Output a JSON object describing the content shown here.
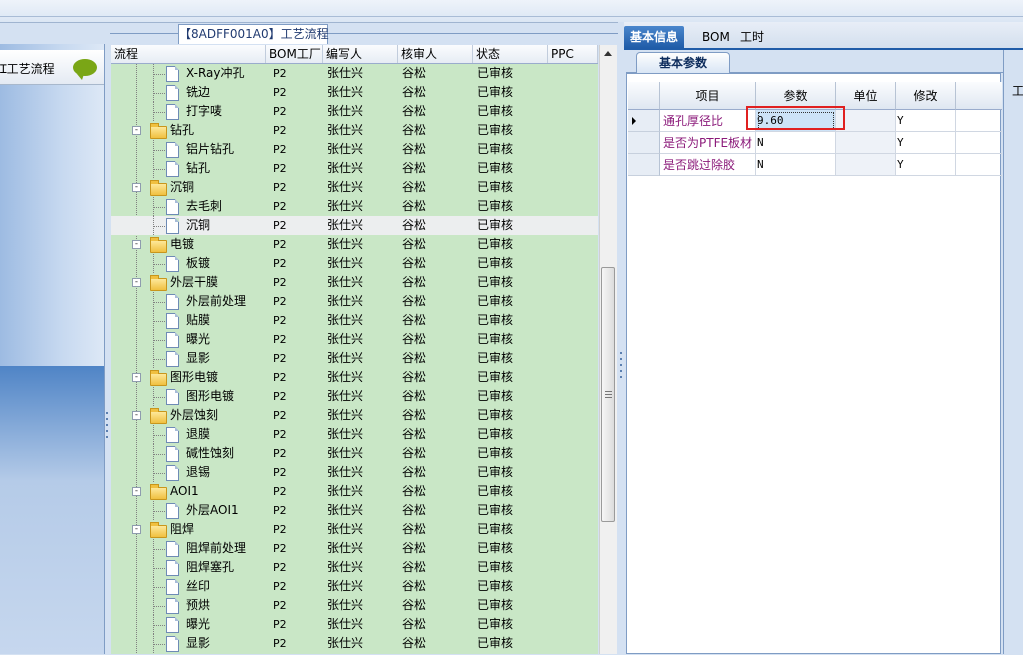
{
  "left_panel": {
    "item_label": "Ɪ工艺流程",
    "bubble_icon": "speech-bubble-icon"
  },
  "middle": {
    "caption": "【8ADFF001A0】工艺流程",
    "columns": [
      "流程",
      "BOM工厂",
      "编写人",
      "核审人",
      "状态",
      "PPC"
    ],
    "rows": [
      {
        "name": "X-Ray冲孔",
        "level": 2,
        "type": "file",
        "bom": "P2",
        "writer": "张仕兴",
        "reviewer": "谷松",
        "status": "已审核"
      },
      {
        "name": "铣边",
        "level": 2,
        "type": "file",
        "bom": "P2",
        "writer": "张仕兴",
        "reviewer": "谷松",
        "status": "已审核"
      },
      {
        "name": "打字唛",
        "level": 2,
        "type": "file",
        "bom": "P2",
        "writer": "张仕兴",
        "reviewer": "谷松",
        "status": "已审核"
      },
      {
        "name": "钻孔",
        "level": 1,
        "type": "folder",
        "bom": "P2",
        "writer": "张仕兴",
        "reviewer": "谷松",
        "status": "已审核"
      },
      {
        "name": "铝片钻孔",
        "level": 2,
        "type": "file",
        "bom": "P2",
        "writer": "张仕兴",
        "reviewer": "谷松",
        "status": "已审核"
      },
      {
        "name": "钻孔",
        "level": 2,
        "type": "file",
        "bom": "P2",
        "writer": "张仕兴",
        "reviewer": "谷松",
        "status": "已审核"
      },
      {
        "name": "沉铜",
        "level": 1,
        "type": "folder",
        "bom": "P2",
        "writer": "张仕兴",
        "reviewer": "谷松",
        "status": "已审核"
      },
      {
        "name": "去毛刺",
        "level": 2,
        "type": "file",
        "bom": "P2",
        "writer": "张仕兴",
        "reviewer": "谷松",
        "status": "已审核"
      },
      {
        "name": "沉铜",
        "level": 2,
        "type": "file",
        "bom": "P2",
        "writer": "张仕兴",
        "reviewer": "谷松",
        "status": "已审核",
        "selected": true
      },
      {
        "name": "电镀",
        "level": 1,
        "type": "folder",
        "bom": "P2",
        "writer": "张仕兴",
        "reviewer": "谷松",
        "status": "已审核"
      },
      {
        "name": "板镀",
        "level": 2,
        "type": "file",
        "bom": "P2",
        "writer": "张仕兴",
        "reviewer": "谷松",
        "status": "已审核"
      },
      {
        "name": "外层干膜",
        "level": 1,
        "type": "folder",
        "bom": "P2",
        "writer": "张仕兴",
        "reviewer": "谷松",
        "status": "已审核"
      },
      {
        "name": "外层前处理",
        "level": 2,
        "type": "file",
        "bom": "P2",
        "writer": "张仕兴",
        "reviewer": "谷松",
        "status": "已审核"
      },
      {
        "name": "贴膜",
        "level": 2,
        "type": "file",
        "bom": "P2",
        "writer": "张仕兴",
        "reviewer": "谷松",
        "status": "已审核"
      },
      {
        "name": "曝光",
        "level": 2,
        "type": "file",
        "bom": "P2",
        "writer": "张仕兴",
        "reviewer": "谷松",
        "status": "已审核"
      },
      {
        "name": "显影",
        "level": 2,
        "type": "file",
        "bom": "P2",
        "writer": "张仕兴",
        "reviewer": "谷松",
        "status": "已审核"
      },
      {
        "name": "图形电镀",
        "level": 1,
        "type": "folder",
        "bom": "P2",
        "writer": "张仕兴",
        "reviewer": "谷松",
        "status": "已审核"
      },
      {
        "name": "图形电镀",
        "level": 2,
        "type": "file",
        "bom": "P2",
        "writer": "张仕兴",
        "reviewer": "谷松",
        "status": "已审核"
      },
      {
        "name": "外层蚀刻",
        "level": 1,
        "type": "folder",
        "bom": "P2",
        "writer": "张仕兴",
        "reviewer": "谷松",
        "status": "已审核"
      },
      {
        "name": "退膜",
        "level": 2,
        "type": "file",
        "bom": "P2",
        "writer": "张仕兴",
        "reviewer": "谷松",
        "status": "已审核"
      },
      {
        "name": "碱性蚀刻",
        "level": 2,
        "type": "file",
        "bom": "P2",
        "writer": "张仕兴",
        "reviewer": "谷松",
        "status": "已审核"
      },
      {
        "name": "退锡",
        "level": 2,
        "type": "file",
        "bom": "P2",
        "writer": "张仕兴",
        "reviewer": "谷松",
        "status": "已审核"
      },
      {
        "name": "AOI1",
        "level": 1,
        "type": "folder",
        "bom": "P2",
        "writer": "张仕兴",
        "reviewer": "谷松",
        "status": "已审核"
      },
      {
        "name": "外层AOI1",
        "level": 2,
        "type": "file",
        "bom": "P2",
        "writer": "张仕兴",
        "reviewer": "谷松",
        "status": "已审核"
      },
      {
        "name": "阻焊",
        "level": 1,
        "type": "folder",
        "bom": "P2",
        "writer": "张仕兴",
        "reviewer": "谷松",
        "status": "已审核"
      },
      {
        "name": "阻焊前处理",
        "level": 2,
        "type": "file",
        "bom": "P2",
        "writer": "张仕兴",
        "reviewer": "谷松",
        "status": "已审核"
      },
      {
        "name": "阻焊塞孔",
        "level": 2,
        "type": "file",
        "bom": "P2",
        "writer": "张仕兴",
        "reviewer": "谷松",
        "status": "已审核"
      },
      {
        "name": "丝印",
        "level": 2,
        "type": "file",
        "bom": "P2",
        "writer": "张仕兴",
        "reviewer": "谷松",
        "status": "已审核"
      },
      {
        "name": "预烘",
        "level": 2,
        "type": "file",
        "bom": "P2",
        "writer": "张仕兴",
        "reviewer": "谷松",
        "status": "已审核"
      },
      {
        "name": "曝光",
        "level": 2,
        "type": "file",
        "bom": "P2",
        "writer": "张仕兴",
        "reviewer": "谷松",
        "status": "已审核"
      },
      {
        "name": "显影",
        "level": 2,
        "type": "file",
        "bom": "P2",
        "writer": "张仕兴",
        "reviewer": "谷松",
        "status": "已审核"
      }
    ]
  },
  "right": {
    "tabs": [
      "基本信息",
      "BOM",
      "工时"
    ],
    "active_tab": "基本信息",
    "sub_tab": "基本参数",
    "param_columns": [
      "项目",
      "参数",
      "单位",
      "修改"
    ],
    "params": [
      {
        "item": "通孔厚径比",
        "value": "9.60",
        "unit": "",
        "modify": "Y",
        "highlight": true,
        "current": true
      },
      {
        "item": "是否为PTFE板材",
        "value": "N",
        "unit": "",
        "modify": "Y"
      },
      {
        "item": "是否跳过除胶",
        "value": "N",
        "unit": "",
        "modify": "Y"
      }
    ],
    "edge_label": "工"
  },
  "colors": {
    "grid_bg": "#c9e7c6",
    "accent": "#1f5ca8",
    "param_item_text": "#8b1a7a",
    "highlight_border": "#e02020"
  }
}
